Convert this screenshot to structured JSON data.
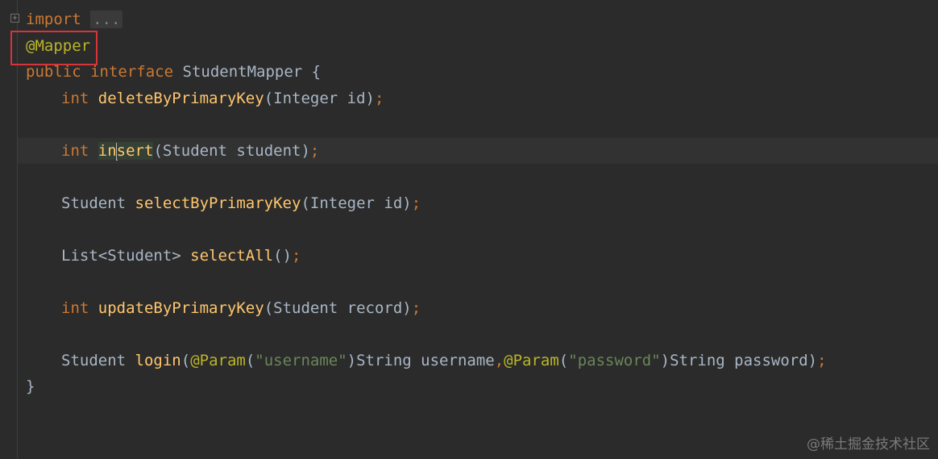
{
  "editor": {
    "lines": {
      "l1": {
        "import_kw": "import",
        "folded": "..."
      },
      "l2": {
        "annotation": "@Mapper"
      },
      "l3": {
        "public_kw": "public",
        "interface_kw": "interface",
        "class_name": "StudentMapper",
        "brace": "{"
      },
      "l4": {
        "type": "int",
        "method": "deleteByPrimaryKey",
        "args": "(Integer id)",
        "semi": ";"
      },
      "l5": {
        "type": "int",
        "method_a": "in",
        "method_b": "sert",
        "args": "(Student student)",
        "semi": ";"
      },
      "l6": {
        "type": "Student",
        "method": "selectByPrimaryKey",
        "args": "(Integer id)",
        "semi": ";"
      },
      "l7": {
        "type": "List<Student>",
        "method": "selectAll",
        "args": "()",
        "semi": ";"
      },
      "l8": {
        "type": "int",
        "method": "updateByPrimaryKey",
        "args": "(Student record)",
        "semi": ";"
      },
      "l9": {
        "type": "Student",
        "method": "login",
        "open": "(",
        "ann1": "@Param",
        "p1_open": "(",
        "str1": "\"username\"",
        "p1_rest": ")String username",
        "comma": ",",
        "ann2": "@Param",
        "p2_open": "(",
        "str2": "\"password\"",
        "p2_rest": ")String password)",
        "semi": ";"
      },
      "l10": {
        "brace": "}"
      }
    },
    "fold_marker": "+"
  },
  "watermark": "@稀土掘金技术社区",
  "colors": {
    "background": "#2b2b2b",
    "keyword": "#cc7832",
    "method": "#ffc66d",
    "annotation": "#bbb529",
    "string": "#6a8759",
    "identifier": "#a9b7c6",
    "highlight_box": "#d6333b"
  }
}
